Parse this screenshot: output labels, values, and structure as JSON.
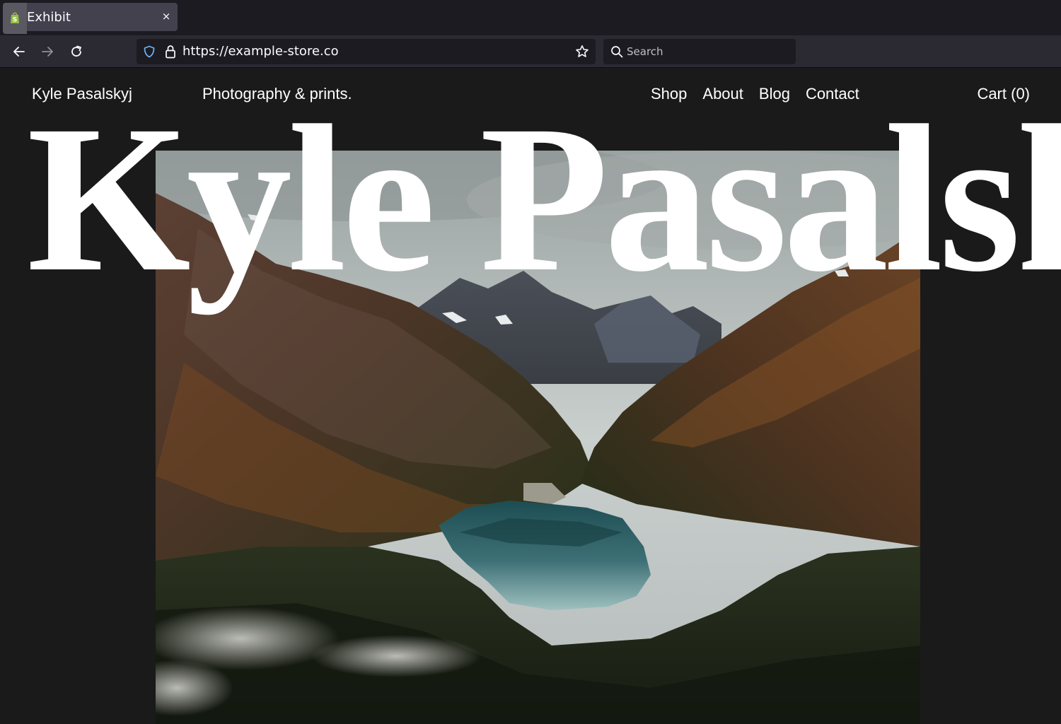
{
  "browser": {
    "tab": {
      "title": "Exhibit",
      "close_glyph": "×",
      "favicon": "shopify-bag-icon"
    },
    "url": "https://example-store.co",
    "search": {
      "placeholder": "Search"
    },
    "icons": [
      "back-arrow-icon",
      "forward-arrow-icon",
      "reload-icon",
      "shield-icon",
      "lock-icon",
      "star-icon",
      "search-icon"
    ]
  },
  "site": {
    "brand": "Kyle Pasalskyj",
    "tagline": "Photography & prints.",
    "nav": [
      {
        "label": "Shop"
      },
      {
        "label": "About"
      },
      {
        "label": "Blog"
      },
      {
        "label": "Contact"
      }
    ],
    "cart": "Cart (0)",
    "hero_title": "Kyle Pasalskyj"
  },
  "colors": {
    "chrome_bg": "#1c1b22",
    "toolbar_bg": "#2b2a33",
    "tab_active": "#42414d",
    "page_bg": "#1a1a1a",
    "text": "#ffffff",
    "shield_accent": "#6fb3f7"
  }
}
